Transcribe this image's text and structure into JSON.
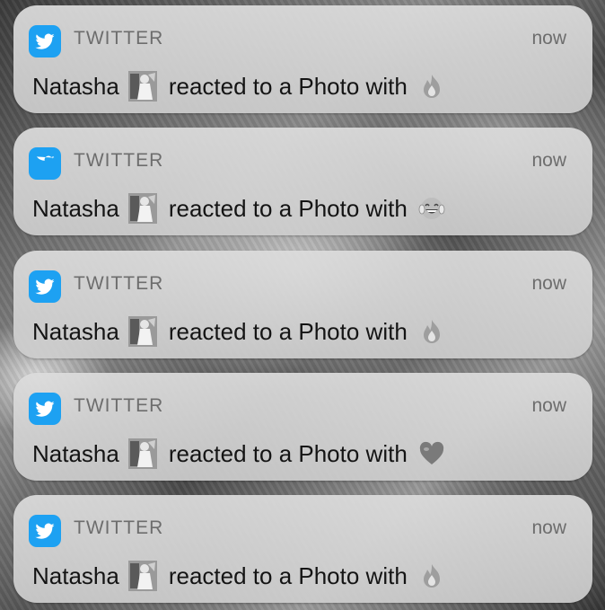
{
  "notifications": [
    {
      "app": "TWITTER",
      "time": "now",
      "sender": "Natasha",
      "text": "reacted to a Photo with",
      "reaction": "fire-emoji"
    },
    {
      "app": "TWITTER",
      "time": "now",
      "sender": "Natasha",
      "text": "reacted to a Photo with",
      "reaction": "tears-of-joy-emoji"
    },
    {
      "app": "TWITTER",
      "time": "now",
      "sender": "Natasha",
      "text": "reacted to a Photo with",
      "reaction": "fire-emoji"
    },
    {
      "app": "TWITTER",
      "time": "now",
      "sender": "Natasha",
      "text": "reacted to a Photo with",
      "reaction": "heart-emoji"
    },
    {
      "app": "TWITTER",
      "time": "now",
      "sender": "Natasha",
      "text": "reacted to a Photo with",
      "reaction": "fire-emoji"
    }
  ],
  "colors": {
    "twitter_blue": "#1DA1F2",
    "card": "#d6d6d6",
    "meta_text": "#6d6d6d",
    "body_text": "#141414"
  }
}
